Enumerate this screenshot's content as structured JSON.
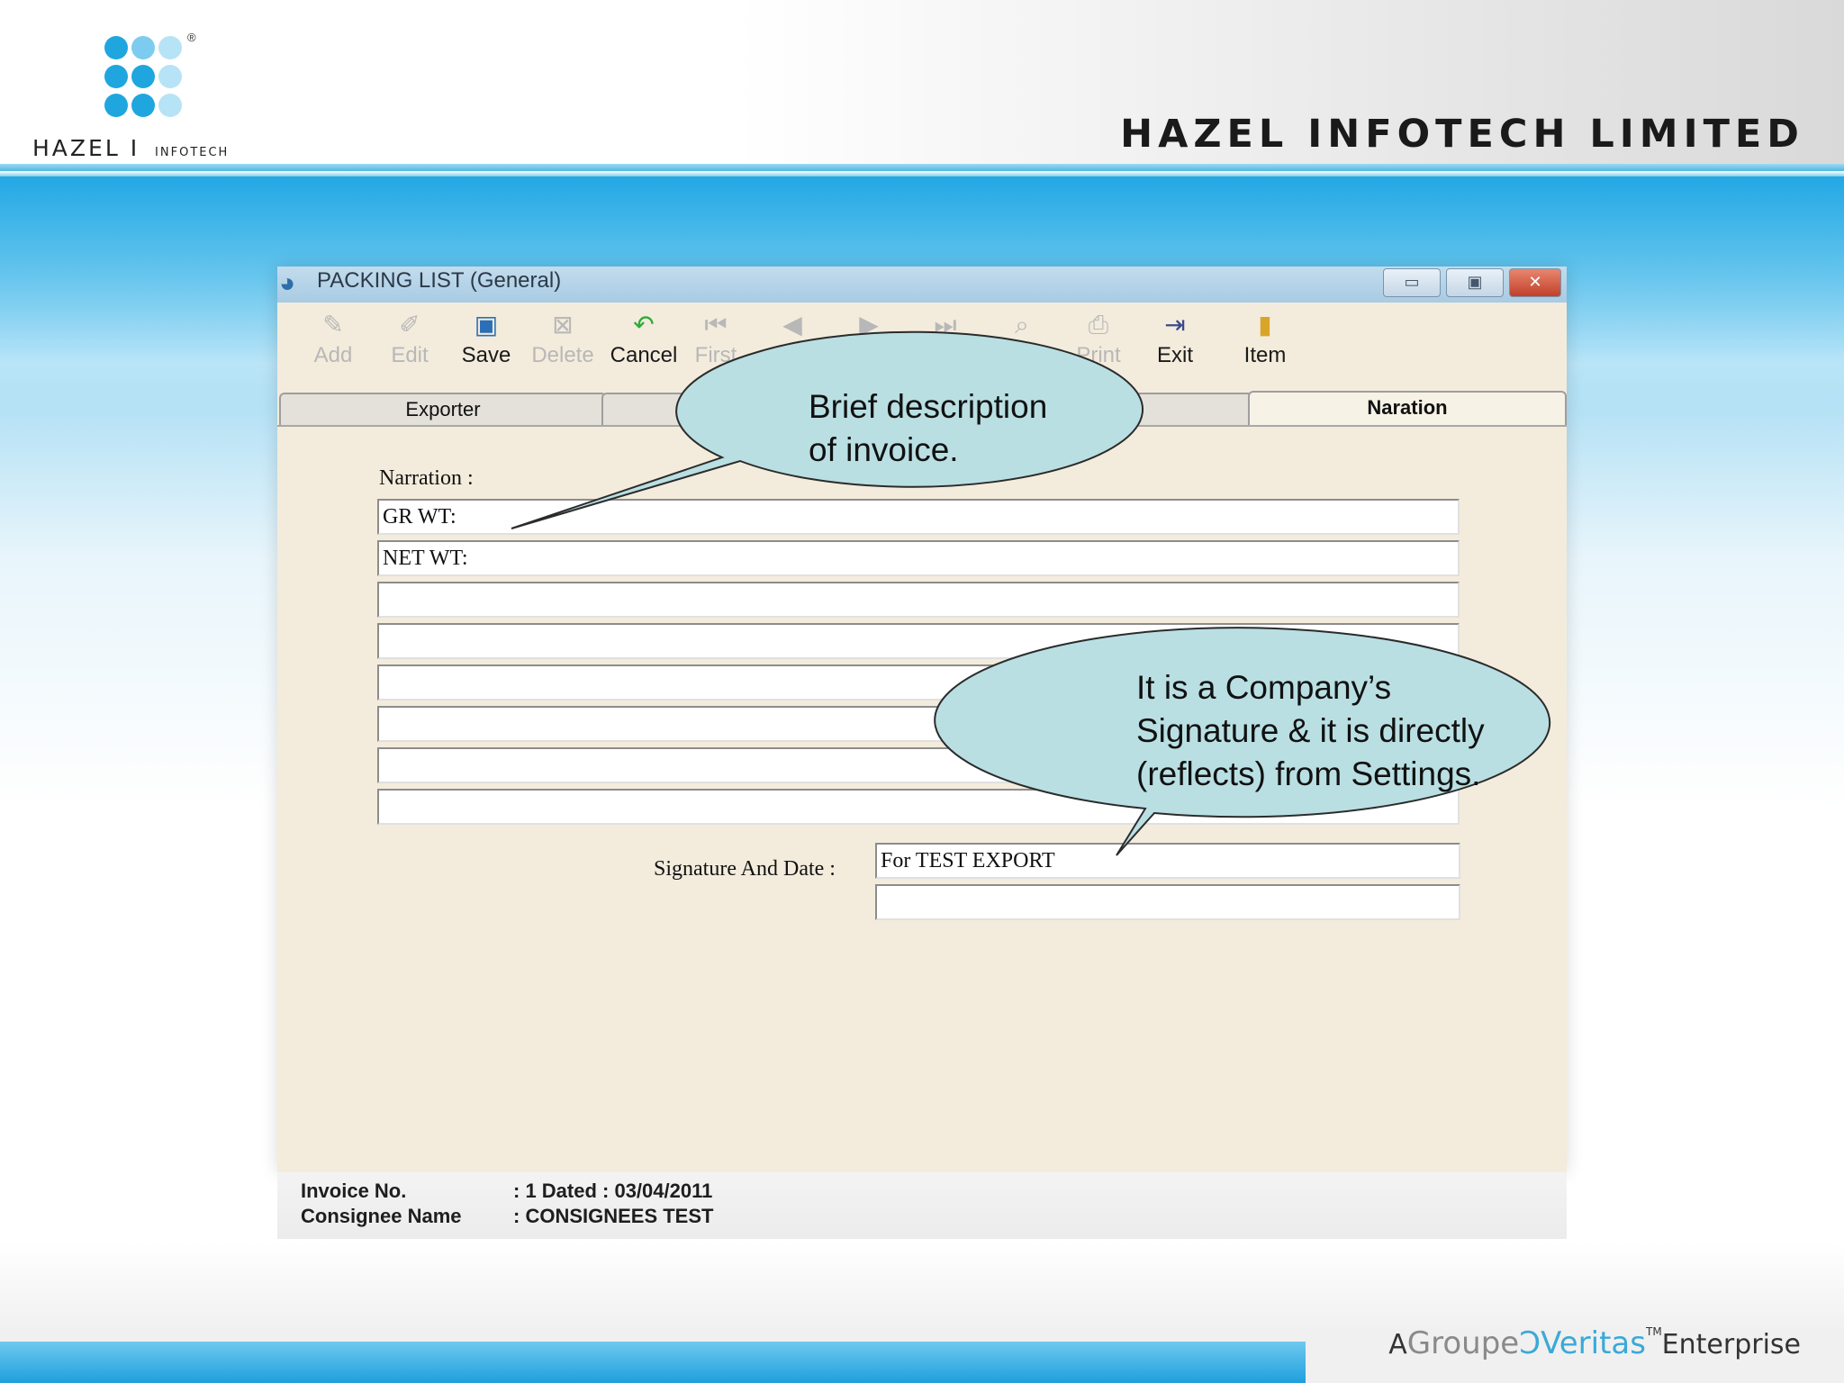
{
  "header": {
    "logo_word": "HAZEL",
    "logo_divider": "I",
    "logo_sub": "INFOTECH",
    "registered_mark": "®",
    "company_title": "HAZEL INFOTECH LIMITED"
  },
  "window": {
    "title": "PACKING LIST (General)",
    "controls": {
      "minimize": "▭",
      "maximize": "▣",
      "close": "✕"
    },
    "toolbar": [
      {
        "label": "Add",
        "icon": "add-icon",
        "enabled": false
      },
      {
        "label": "Edit",
        "icon": "edit-icon",
        "enabled": false
      },
      {
        "label": "Save",
        "icon": "save-icon",
        "enabled": true
      },
      {
        "label": "Delete",
        "icon": "delete-icon",
        "enabled": false
      },
      {
        "label": "Cancel",
        "icon": "cancel-icon",
        "enabled": true
      },
      {
        "label": "First",
        "icon": "first-icon",
        "enabled": false
      },
      {
        "label": "Prev",
        "icon": "prev-icon",
        "enabled": false
      },
      {
        "label": "",
        "icon": "next-icon",
        "enabled": false
      },
      {
        "label": "",
        "icon": "last-icon",
        "enabled": false
      },
      {
        "label": "",
        "icon": "find-icon",
        "enabled": false
      },
      {
        "label": "Print",
        "icon": "print-icon",
        "enabled": false
      },
      {
        "label": "Exit",
        "icon": "exit-icon",
        "enabled": true
      },
      {
        "label": "Item",
        "icon": "item-icon",
        "enabled": true
      }
    ],
    "tabs": [
      {
        "label": "Exporter",
        "active": false
      },
      {
        "label": "",
        "active": false
      },
      {
        "label": "Naration",
        "active": true
      }
    ],
    "narration": {
      "label": "Narration :",
      "lines": [
        "GR WT:",
        "NET WT:",
        "",
        "",
        "",
        "",
        "",
        ""
      ]
    },
    "signature": {
      "label": "Signature And Date :",
      "lines": [
        "For TEST EXPORT",
        ""
      ]
    }
  },
  "status": {
    "invoice_label": "Invoice No.",
    "invoice_value": ": 1   Dated : 03/04/2011",
    "consignee_label": "Consignee Name",
    "consignee_value": ": CONSIGNEES TEST"
  },
  "callouts": {
    "narration_note_line1": "Brief description",
    "narration_note_line2": "of invoice.",
    "signature_note_line1": "It is a Company’s",
    "signature_note_line2": "Signature & it is directly",
    "signature_note_line3": "(reflects) from Settings."
  },
  "footer": {
    "prefix": "A",
    "groupe": "Groupe",
    "veritas": "Veritas",
    "tm": "TM",
    "suffix": "Enterprise"
  },
  "colors": {
    "accent_blue": "#23a8e4",
    "callout_fill": "#b9dfe3",
    "window_bg": "#f3ecdc"
  }
}
